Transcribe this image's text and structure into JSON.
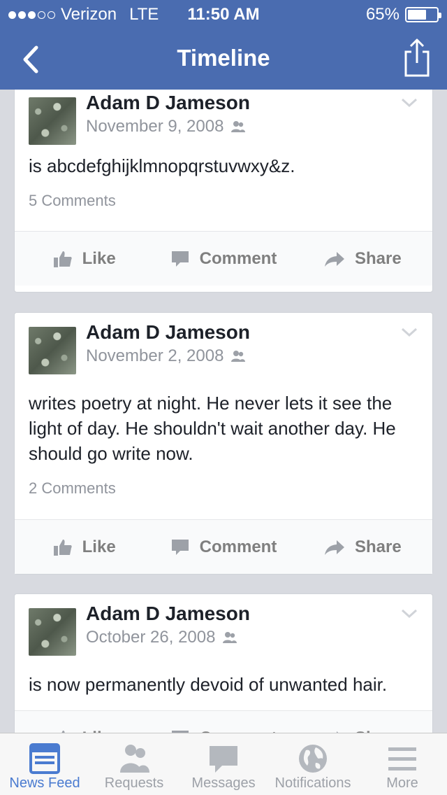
{
  "status": {
    "carrier": "Verizon",
    "network": "LTE",
    "time": "11:50 AM",
    "battery": "65%",
    "battery_level": 0.65,
    "signal_bars": 3
  },
  "nav": {
    "title": "Timeline",
    "back_icon": "chevron-left-icon",
    "share_icon": "share-icon"
  },
  "posts": [
    {
      "author": "Adam D Jameson",
      "date": "November 9, 2008",
      "text": "is abcdefghijklmnopqrstuvwxy&z.",
      "comments": "5 Comments"
    },
    {
      "author": "Adam D Jameson",
      "date": "November 2, 2008",
      "text": "writes poetry at night. He never lets it see the light of day. He shouldn't wait another day. He should go write now.",
      "comments": "2 Comments"
    },
    {
      "author": "Adam D Jameson",
      "date": "October 26, 2008",
      "text": "is now permanently devoid of unwanted hair.",
      "comments": ""
    }
  ],
  "actions": {
    "like": "Like",
    "comment": "Comment",
    "share": "Share"
  },
  "tabs": [
    {
      "label": "News Feed",
      "icon": "news-feed-icon",
      "active": true
    },
    {
      "label": "Requests",
      "icon": "requests-icon",
      "active": false
    },
    {
      "label": "Messages",
      "icon": "messages-icon",
      "active": false
    },
    {
      "label": "Notifications",
      "icon": "globe-icon",
      "active": false
    },
    {
      "label": "More",
      "icon": "menu-icon",
      "active": false
    }
  ],
  "colors": {
    "brand": "#4a6cb0",
    "active_tab": "#4a7bd0",
    "muted": "#90949c"
  }
}
